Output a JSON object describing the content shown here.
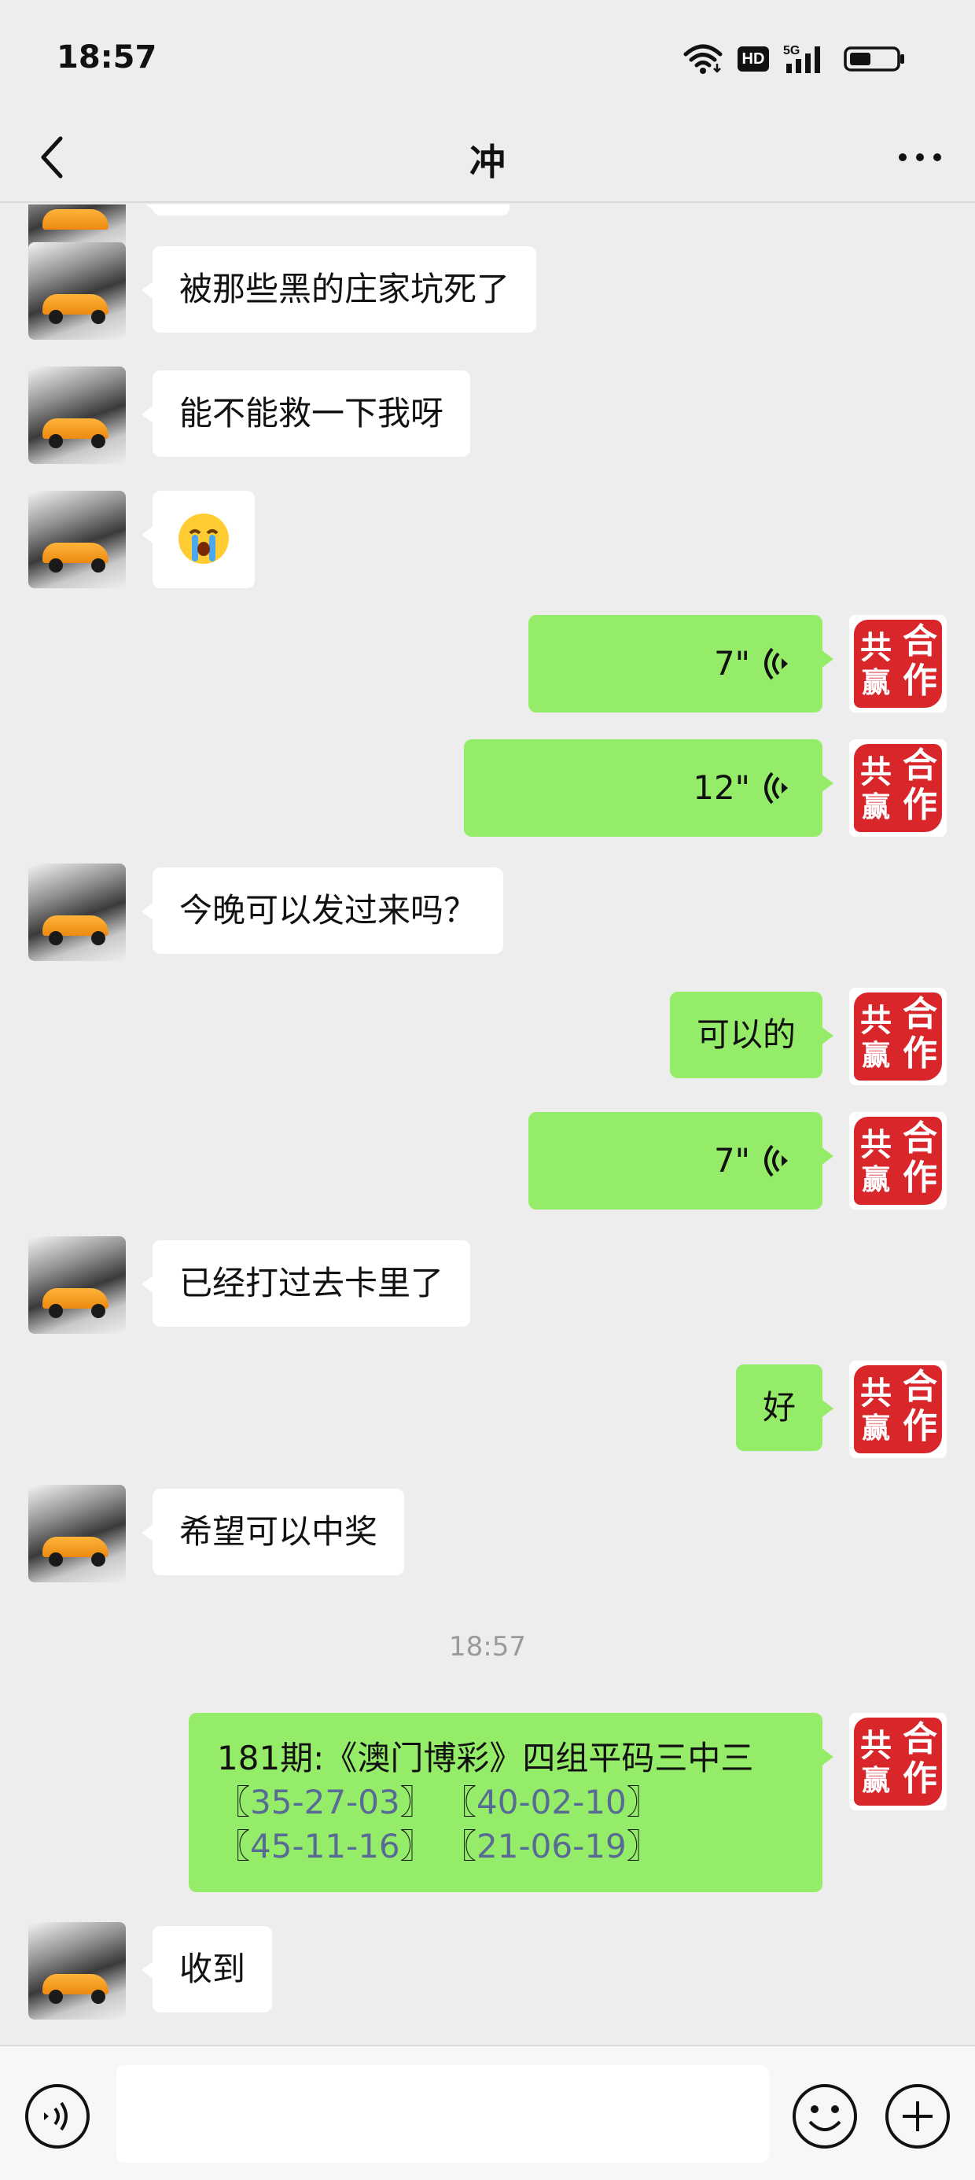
{
  "status_bar": {
    "time": "18:57",
    "hd_label": "HD",
    "network_label": "5G"
  },
  "header": {
    "title": "冲"
  },
  "messages": [
    {
      "side": "in",
      "type": "text",
      "text": "被那些黑的庄家坑死了"
    },
    {
      "side": "in",
      "type": "text",
      "text": "能不能救一下我呀"
    },
    {
      "side": "in",
      "type": "emoji",
      "icon": "crying-face-emoji",
      "text": "😭"
    },
    {
      "side": "out",
      "type": "voice",
      "duration": "7\""
    },
    {
      "side": "out",
      "type": "voice",
      "duration": "12\""
    },
    {
      "side": "in",
      "type": "text",
      "text": "今晚可以发过来吗？"
    },
    {
      "side": "out",
      "type": "text",
      "text": "可以的"
    },
    {
      "side": "out",
      "type": "voice",
      "duration": "7\""
    },
    {
      "side": "in",
      "type": "text",
      "text": "已经打过去卡里了"
    },
    {
      "side": "out",
      "type": "text",
      "text": "好"
    },
    {
      "side": "in",
      "type": "text",
      "text": "希望可以中奖"
    },
    {
      "side": "system",
      "type": "timestamp",
      "text": "18:57"
    },
    {
      "side": "out",
      "type": "multiline",
      "line1": "181期:《澳门博彩》四组平码三中三",
      "code1": "35-27-03",
      "code2": "40-02-10",
      "code3": "45-11-16",
      "code4": "21-06-19",
      "open_bracket": "〖",
      "close_bracket": "〗"
    },
    {
      "side": "in",
      "type": "text",
      "text": "收到"
    }
  ],
  "avatars": {
    "self_seal_chars": [
      "合",
      "作",
      "共",
      "赢"
    ],
    "self_seal_color": "#d8262a",
    "contact_avatar_icon": "sports-car-avatar"
  },
  "input_bar": {
    "text_value": "",
    "voice_icon": "voice-input-icon",
    "emoji_icon": "emoji-icon",
    "more_icon": "plus-icon"
  },
  "colors": {
    "background": "#ededed",
    "bubble_out": "#95ec69",
    "bubble_in": "#ffffff",
    "link": "#576b95",
    "timestamp": "#9a9a9a"
  }
}
